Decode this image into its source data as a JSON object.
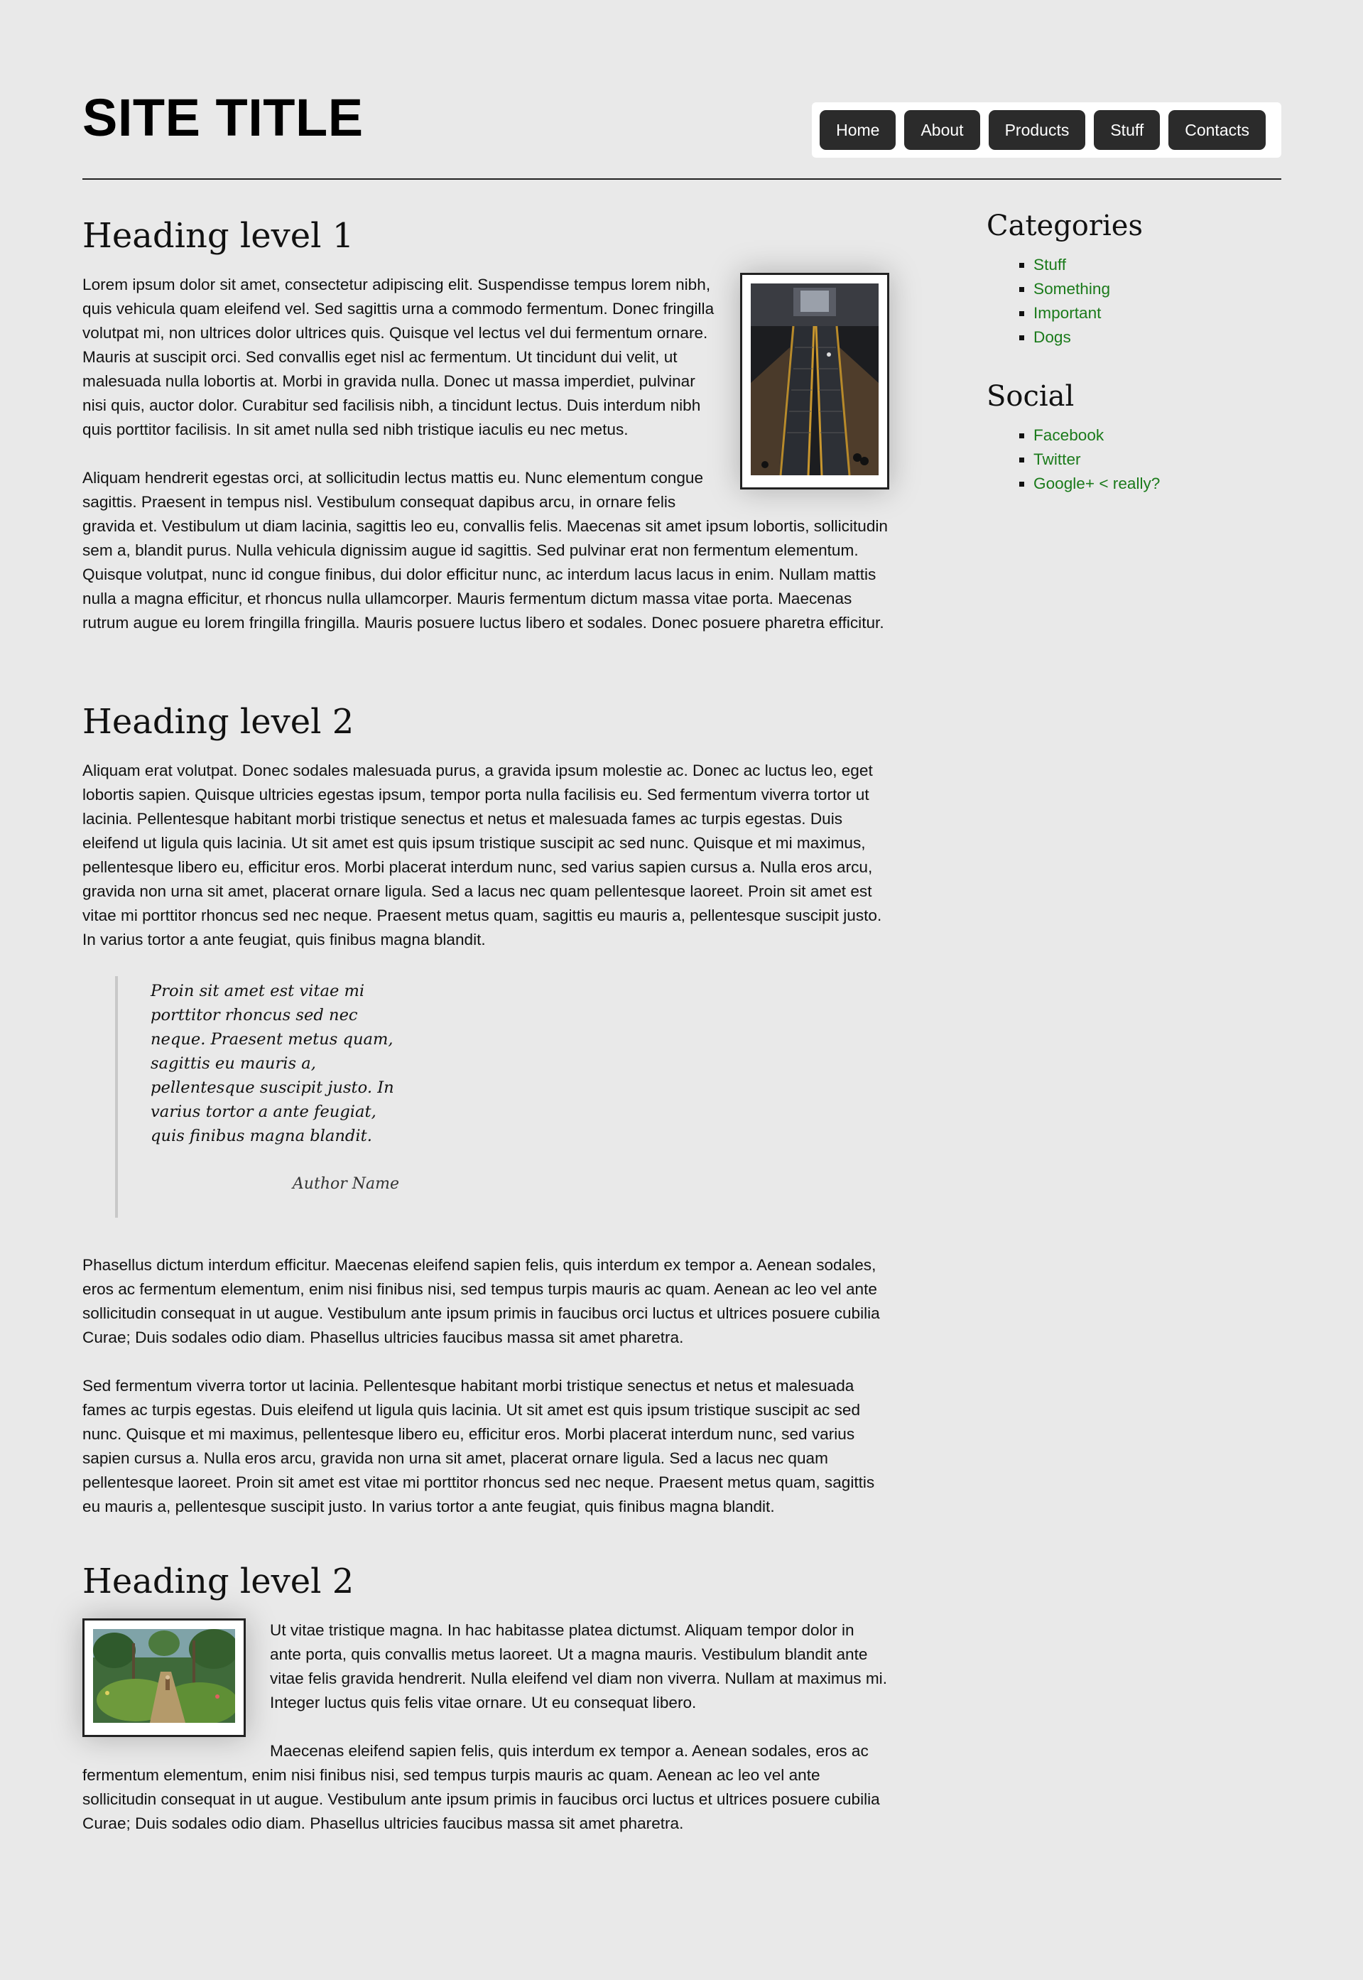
{
  "header": {
    "site_title": "SITE TITLE",
    "nav": [
      "Home",
      "About",
      "Products",
      "Stuff",
      "Contacts"
    ]
  },
  "main": {
    "section1": {
      "heading": "Heading level 1",
      "p1": "Lorem ipsum dolor sit amet, consectetur adipiscing elit. Suspendisse tempus lorem nibh, quis vehicula quam eleifend vel. Sed sagittis urna a commodo fermentum. Donec fringilla volutpat mi, non ultrices dolor ultrices quis. Quisque vel lectus vel dui fermentum ornare. Mauris at suscipit orci. Sed convallis eget nisl ac fermentum. Ut tincidunt dui velit, ut malesuada nulla lobortis at. Morbi in gravida nulla. Donec ut massa imperdiet, pulvinar nisi quis, auctor dolor. Curabitur sed facilisis nibh, a tincidunt lectus. Duis interdum nibh quis porttitor facilisis. In sit amet nulla sed nibh tristique iaculis eu nec metus.",
      "p2": "Aliquam hendrerit egestas orci, at sollicitudin lectus mattis eu. Nunc elementum congue sagittis. Praesent in tempus nisl. Vestibulum consequat dapibus arcu, in ornare felis gravida et. Vestibulum ut diam lacinia, sagittis leo eu, convallis felis. Maecenas sit amet ipsum lobortis, sollicitudin sem a, blandit purus. Nulla vehicula dignissim augue id sagittis. Sed pulvinar erat non fermentum elementum. Quisque volutpat, nunc id congue finibus, dui dolor efficitur nunc, ac interdum lacus lacus in enim. Nullam mattis nulla a magna efficitur, et rhoncus nulla ullamcorper. Mauris fermentum dictum massa vitae porta. Maecenas rutrum augue eu lorem fringilla fringilla. Mauris posuere luctus libero et sodales. Donec posuere pharetra efficitur."
    },
    "section2": {
      "heading": "Heading level 2",
      "p1": "Aliquam erat volutpat. Donec sodales malesuada purus, a gravida ipsum molestie ac. Donec ac luctus leo, eget lobortis sapien. Quisque ultricies egestas ipsum, tempor porta nulla facilisis eu. Sed fermentum viverra tortor ut lacinia. Pellentesque habitant morbi tristique senectus et netus et malesuada fames ac turpis egestas. Duis eleifend ut ligula quis lacinia. Ut sit amet est quis ipsum tristique suscipit ac sed nunc. Quisque et mi maximus, pellentesque libero eu, efficitur eros. Morbi placerat interdum nunc, sed varius sapien cursus a. Nulla eros arcu, gravida non urna sit amet, placerat ornare ligula. Sed a lacus nec quam pellentesque laoreet. Proin sit amet est vitae mi porttitor rhoncus sed nec neque. Praesent metus quam, sagittis eu mauris a, pellentesque suscipit justo. In varius tortor a ante feugiat, quis finibus magna blandit.",
      "quote": "Proin sit amet est vitae mi porttitor rhoncus sed nec neque. Praesent metus quam, sagittis eu mauris a, pellentesque suscipit justo. In varius tortor a ante feugiat, quis finibus magna blandit.",
      "quote_author": "Author Name",
      "p2": "Phasellus dictum interdum efficitur. Maecenas eleifend sapien felis, quis interdum ex tempor a. Aenean sodales, eros ac fermentum elementum, enim nisi finibus nisi, sed tempus turpis mauris ac quam. Aenean ac leo vel ante sollicitudin consequat in ut augue. Vestibulum ante ipsum primis in faucibus orci luctus et ultrices posuere cubilia Curae; Duis sodales odio diam. Phasellus ultricies faucibus massa sit amet pharetra.",
      "p3": "Sed fermentum viverra tortor ut lacinia. Pellentesque habitant morbi tristique senectus et netus et malesuada fames ac turpis egestas. Duis eleifend ut ligula quis lacinia. Ut sit amet est quis ipsum tristique suscipit ac sed nunc. Quisque et mi maximus, pellentesque libero eu, efficitur eros. Morbi placerat interdum nunc, sed varius sapien cursus a. Nulla eros arcu, gravida non urna sit amet, placerat ornare ligula. Sed a lacus nec quam pellentesque laoreet. Proin sit amet est vitae mi porttitor rhoncus sed nec neque. Praesent metus quam, sagittis eu mauris a, pellentesque suscipit justo. In varius tortor a ante feugiat, quis finibus magna blandit."
    },
    "section3": {
      "heading": "Heading level 2",
      "p1": "Ut vitae tristique magna. In hac habitasse platea dictumst. Aliquam tempor dolor in ante porta, quis convallis metus laoreet. Ut a magna mauris. Vestibulum blandit ante vitae felis gravida hendrerit. Nulla eleifend vel diam non viverra. Nullam at maximus mi. Integer luctus quis felis vitae ornare. Ut eu consequat libero.",
      "p2": "Maecenas eleifend sapien felis, quis interdum ex tempor a. Aenean sodales, eros ac fermentum elementum, enim nisi finibus nisi, sed tempus turpis mauris ac quam. Aenean ac leo vel ante sollicitudin consequat in ut augue. Vestibulum ante ipsum primis in faucibus orci luctus et ultrices posuere cubilia Curae; Duis sodales odio diam. Phasellus ultricies faucibus massa sit amet pharetra."
    }
  },
  "sidebar": {
    "categories": {
      "heading": "Categories",
      "items": [
        "Stuff",
        "Something",
        "Important",
        "Dogs"
      ]
    },
    "social": {
      "heading": "Social",
      "items": [
        "Facebook",
        "Twitter",
        "Google+ < really?"
      ]
    }
  },
  "colors": {
    "background": "#e9e9e9",
    "nav_button": "#2b2b2b",
    "link": "#1a7a1a"
  }
}
